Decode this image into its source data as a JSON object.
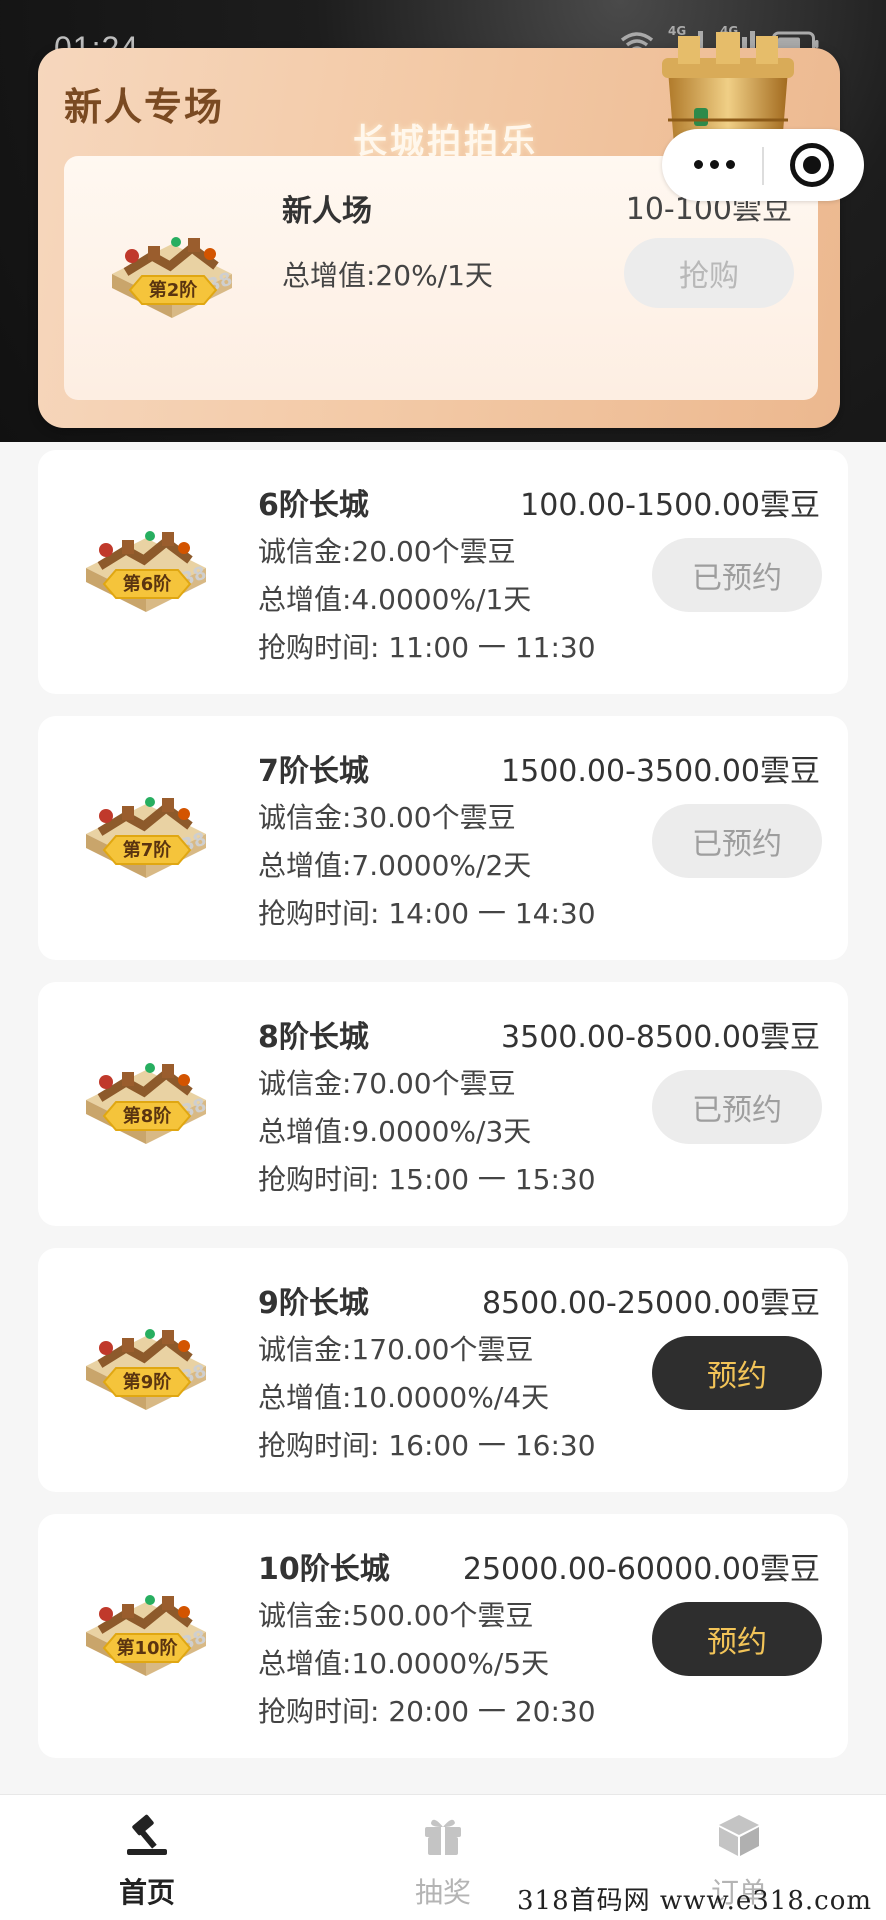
{
  "status_bar": {
    "time": "01:24",
    "network_1": "4G",
    "network_2": "4G"
  },
  "promo": {
    "title": "新人专场",
    "subtitle": "长城拍拍乐",
    "item": {
      "badge": "第2阶",
      "name": "新人场",
      "range": "10-100雲豆",
      "gain": "总增值:20%/1天",
      "button": "抢购"
    }
  },
  "products": [
    {
      "badge": "第6阶",
      "title": "6阶长城",
      "range": "100.00-1500.00雲豆",
      "deposit": "诚信金:20.00个雲豆",
      "gain": "总增值:4.0000%/1天",
      "time": "抢购时间: 11:00 一 11:30",
      "button": "已预约",
      "state": "reserved"
    },
    {
      "badge": "第7阶",
      "title": "7阶长城",
      "range": "1500.00-3500.00雲豆",
      "deposit": "诚信金:30.00个雲豆",
      "gain": "总增值:7.0000%/2天",
      "time": "抢购时间: 14:00 一 14:30",
      "button": "已预约",
      "state": "reserved"
    },
    {
      "badge": "第8阶",
      "title": "8阶长城",
      "range": "3500.00-8500.00雲豆",
      "deposit": "诚信金:70.00个雲豆",
      "gain": "总增值:9.0000%/3天",
      "time": "抢购时间: 15:00 一 15:30",
      "button": "已预约",
      "state": "reserved"
    },
    {
      "badge": "第9阶",
      "title": "9阶长城",
      "range": "8500.00-25000.00雲豆",
      "deposit": "诚信金:170.00个雲豆",
      "gain": "总增值:10.0000%/4天",
      "time": "抢购时间: 16:00 一 16:30",
      "button": "预约",
      "state": "active"
    },
    {
      "badge": "第10阶",
      "title": "10阶长城",
      "range": "25000.00-60000.00雲豆",
      "deposit": "诚信金:500.00个雲豆",
      "gain": "总增值:10.0000%/5天",
      "time": "抢购时间: 20:00 一 20:30",
      "button": "预约",
      "state": "active"
    }
  ],
  "tabs": {
    "home": "首页",
    "draw": "抽奖",
    "order": "订单"
  },
  "watermark": "318首码网 www.e318.com",
  "colors": {
    "accent_gold": "#f2c458",
    "button_dark": "#2e2e2e",
    "reserved_bg": "#ececec",
    "promo_title": "#7a4a22"
  }
}
